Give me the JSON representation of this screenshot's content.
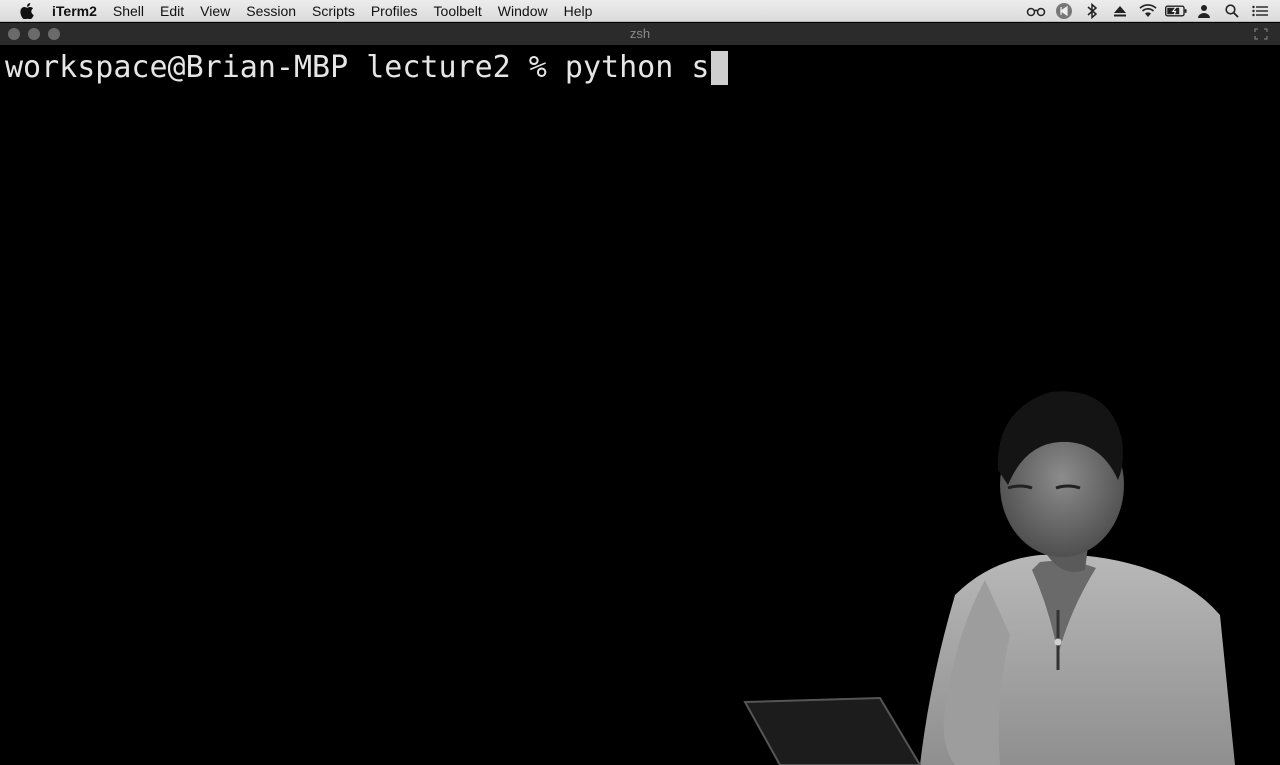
{
  "menubar": {
    "app_name": "iTerm2",
    "items": [
      "Shell",
      "Edit",
      "View",
      "Session",
      "Scripts",
      "Profiles",
      "Toolbelt",
      "Window",
      "Help"
    ],
    "status_icons": [
      "glasses-icon",
      "record-icon",
      "bluetooth-icon",
      "eject-icon",
      "wifi-icon",
      "battery-icon",
      "user-icon",
      "search-icon",
      "list-icon"
    ]
  },
  "window": {
    "title": "zsh"
  },
  "terminal": {
    "prompt": "workspace@Brian-MBP lecture2 % ",
    "command": "python s",
    "bg_color": "#000000",
    "text_color": "#e6e6e6"
  }
}
